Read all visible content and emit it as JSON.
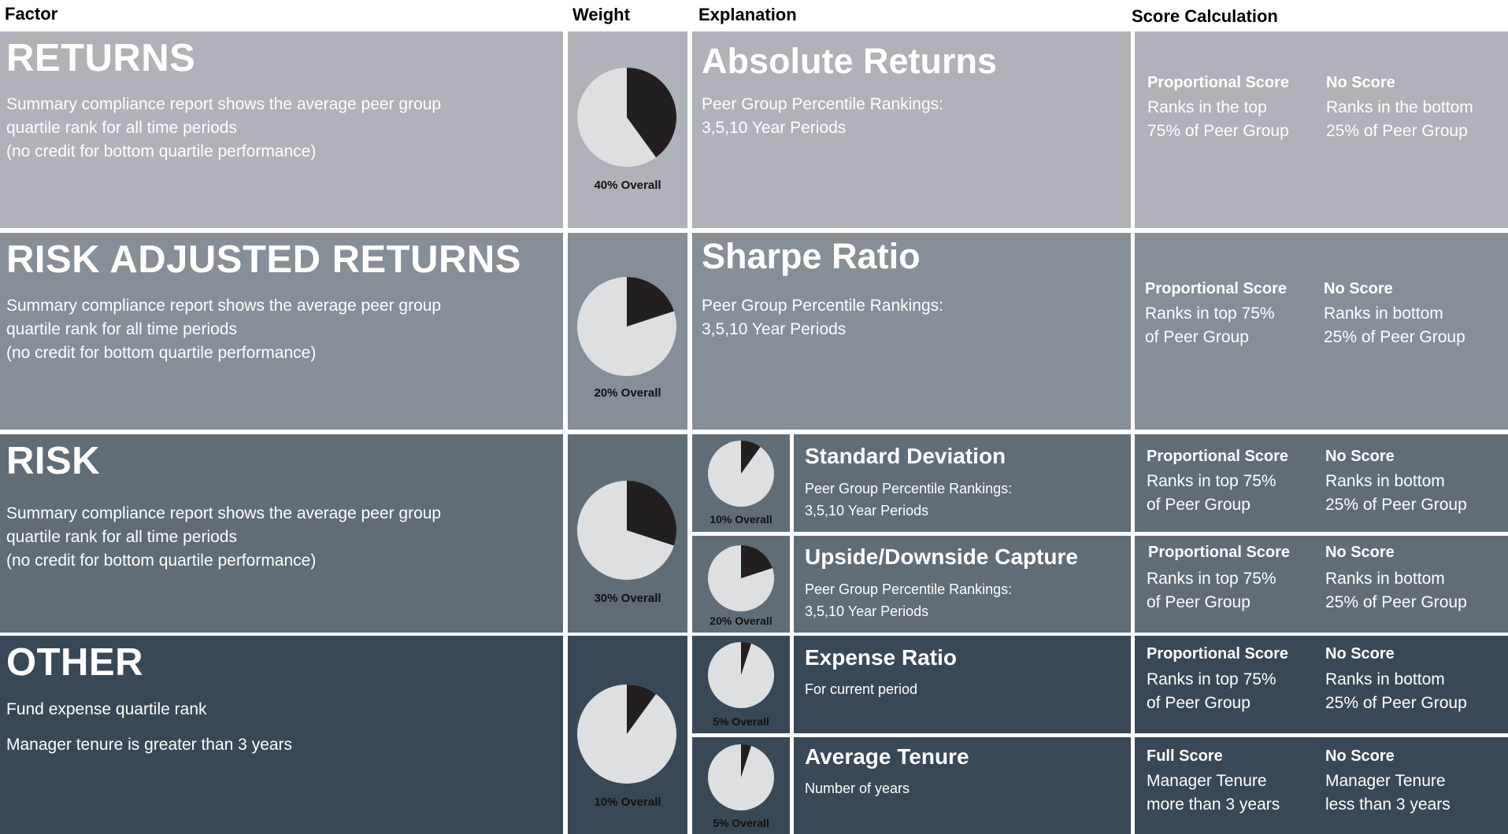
{
  "headers": {
    "factor": "Factor",
    "weight": "Weight",
    "explanation": "Explanation",
    "score": "Score Calculation"
  },
  "colors": {
    "returns": "#adb3b9",
    "risk_adjusted": "#868f97",
    "risk": "#606d77",
    "other": "#394856",
    "pie_light": "#dedfe1",
    "pie_dark": "#231f20"
  },
  "factors": {
    "returns": {
      "title": "RETURNS",
      "desc": "Summary compliance report shows the average peer group\nquartile rank for all time periods\n(no credit for bottom quartile performance)",
      "weight_label": "40% Overall",
      "weight_fraction": 0.4
    },
    "risk_adjusted": {
      "title": "RISK ADJUSTED RETURNS",
      "desc": "Summary compliance report shows the average peer group\nquartile rank for all time periods\n(no credit for bottom quartile performance)",
      "weight_label": "20% Overall",
      "weight_fraction": 0.2
    },
    "risk": {
      "title": "RISK",
      "desc": "Summary compliance report shows the average peer group\nquartile rank for all time periods\n(no credit for bottom quartile performance)",
      "weight_label": "30% Overall",
      "weight_fraction": 0.3
    },
    "other": {
      "title": "OTHER",
      "line1": "Fund expense quartile rank",
      "line2": "Manager tenure is greater than 3 years",
      "weight_label": "10% Overall",
      "weight_fraction": 0.1
    }
  },
  "explanations": {
    "absolute": {
      "title": "Absolute Returns",
      "desc": "Peer Group Percentile Rankings:\n3,5,10 Year Periods"
    },
    "sharpe": {
      "title": "Sharpe Ratio",
      "desc": "Peer Group Percentile Rankings:\n3,5,10 Year Periods"
    },
    "stddev": {
      "title": "Standard Deviation",
      "desc": "Peer Group Percentile Rankings:\n3,5,10 Year Periods",
      "weight_label": "10% Overall",
      "weight_fraction": 0.1
    },
    "capture": {
      "title": "Upside/Downside Capture",
      "desc": "Peer Group Percentile Rankings:\n3,5,10 Year Periods",
      "weight_label": "20% Overall",
      "weight_fraction": 0.2
    },
    "expense": {
      "title": "Expense Ratio",
      "desc": "For current period",
      "weight_label": "5% Overall",
      "weight_fraction": 0.05
    },
    "tenure": {
      "title": "Average Tenure",
      "desc": "Number of years",
      "weight_label": "5% Overall",
      "weight_fraction": 0.05
    }
  },
  "scores": {
    "returns": {
      "left_head": "Proportional Score",
      "left_text": "Ranks in the top\n75% of Peer Group",
      "right_head": "No Score",
      "right_text": "Ranks in the bottom\n25% of Peer Group"
    },
    "risk_adjusted": {
      "left_head": "Proportional Score",
      "left_text": "Ranks in top 75%\nof Peer Group",
      "right_head": "No Score",
      "right_text": "Ranks in bottom\n25% of Peer Group"
    },
    "stddev": {
      "left_head": "Proportional Score",
      "left_text": "Ranks in top 75%\nof Peer Group",
      "right_head": "No Score",
      "right_text": "Ranks in bottom\n25% of Peer Group"
    },
    "capture": {
      "left_head": "Proportional Score",
      "left_text": "Ranks in top 75%\nof Peer Group",
      "right_head": "No Score",
      "right_text": "Ranks in bottom\n25% of Peer Group"
    },
    "expense": {
      "left_head": "Proportional Score",
      "left_text": "Ranks in top 75%\nof Peer Group",
      "right_head": "No Score",
      "right_text": "Ranks in bottom\n25% of Peer Group"
    },
    "tenure": {
      "left_head": "Full Score",
      "left_text": "Manager Tenure\nmore than 3 years",
      "right_head": "No Score",
      "right_text": "Manager Tenure\nless than 3 years"
    }
  }
}
